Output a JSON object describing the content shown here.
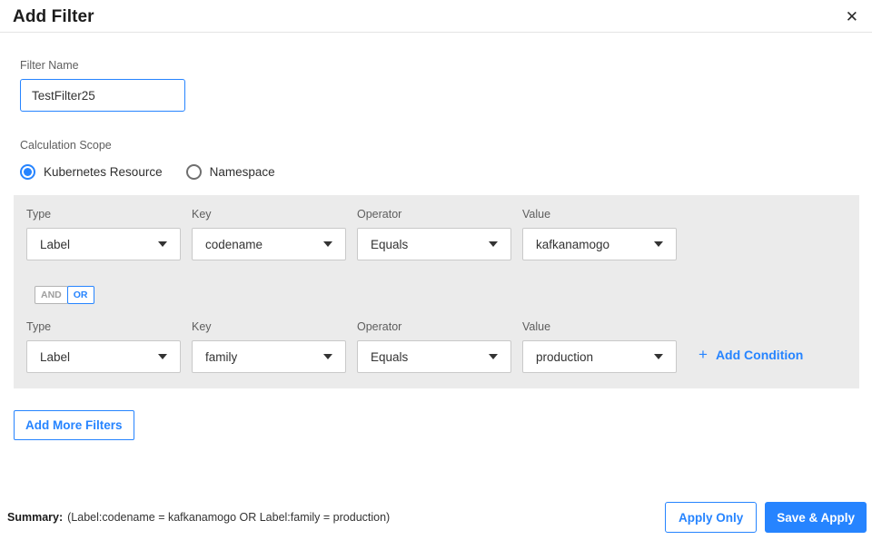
{
  "header": {
    "title": "Add Filter",
    "close_icon": "✕"
  },
  "filter_name": {
    "label": "Filter Name",
    "value": "TestFilter25"
  },
  "calculation_scope": {
    "label": "Calculation Scope",
    "options": [
      {
        "label": "Kubernetes Resource",
        "selected": true
      },
      {
        "label": "Namespace",
        "selected": false
      }
    ]
  },
  "conditions": {
    "columns": {
      "type": "Type",
      "key": "Key",
      "operator": "Operator",
      "value": "Value"
    },
    "rows": [
      {
        "type": "Label",
        "key": "codename",
        "operator": "Equals",
        "value": "kafkanamogo"
      },
      {
        "type": "Label",
        "key": "family",
        "operator": "Equals",
        "value": "production"
      }
    ],
    "logic_toggle": {
      "and_label": "AND",
      "or_label": "OR",
      "selected": "OR"
    },
    "add_condition": {
      "plus_icon": "+",
      "label": "Add Condition"
    }
  },
  "add_more_filters_label": "Add More Filters",
  "footer": {
    "summary_label": "Summary:",
    "summary_text": "(Label:codename = kafkanamogo OR Label:family = production)",
    "apply_only_label": "Apply Only",
    "save_apply_label": "Save & Apply"
  },
  "colors": {
    "accent_blue": "#2684ff",
    "panel_gray": "#ebebeb"
  }
}
